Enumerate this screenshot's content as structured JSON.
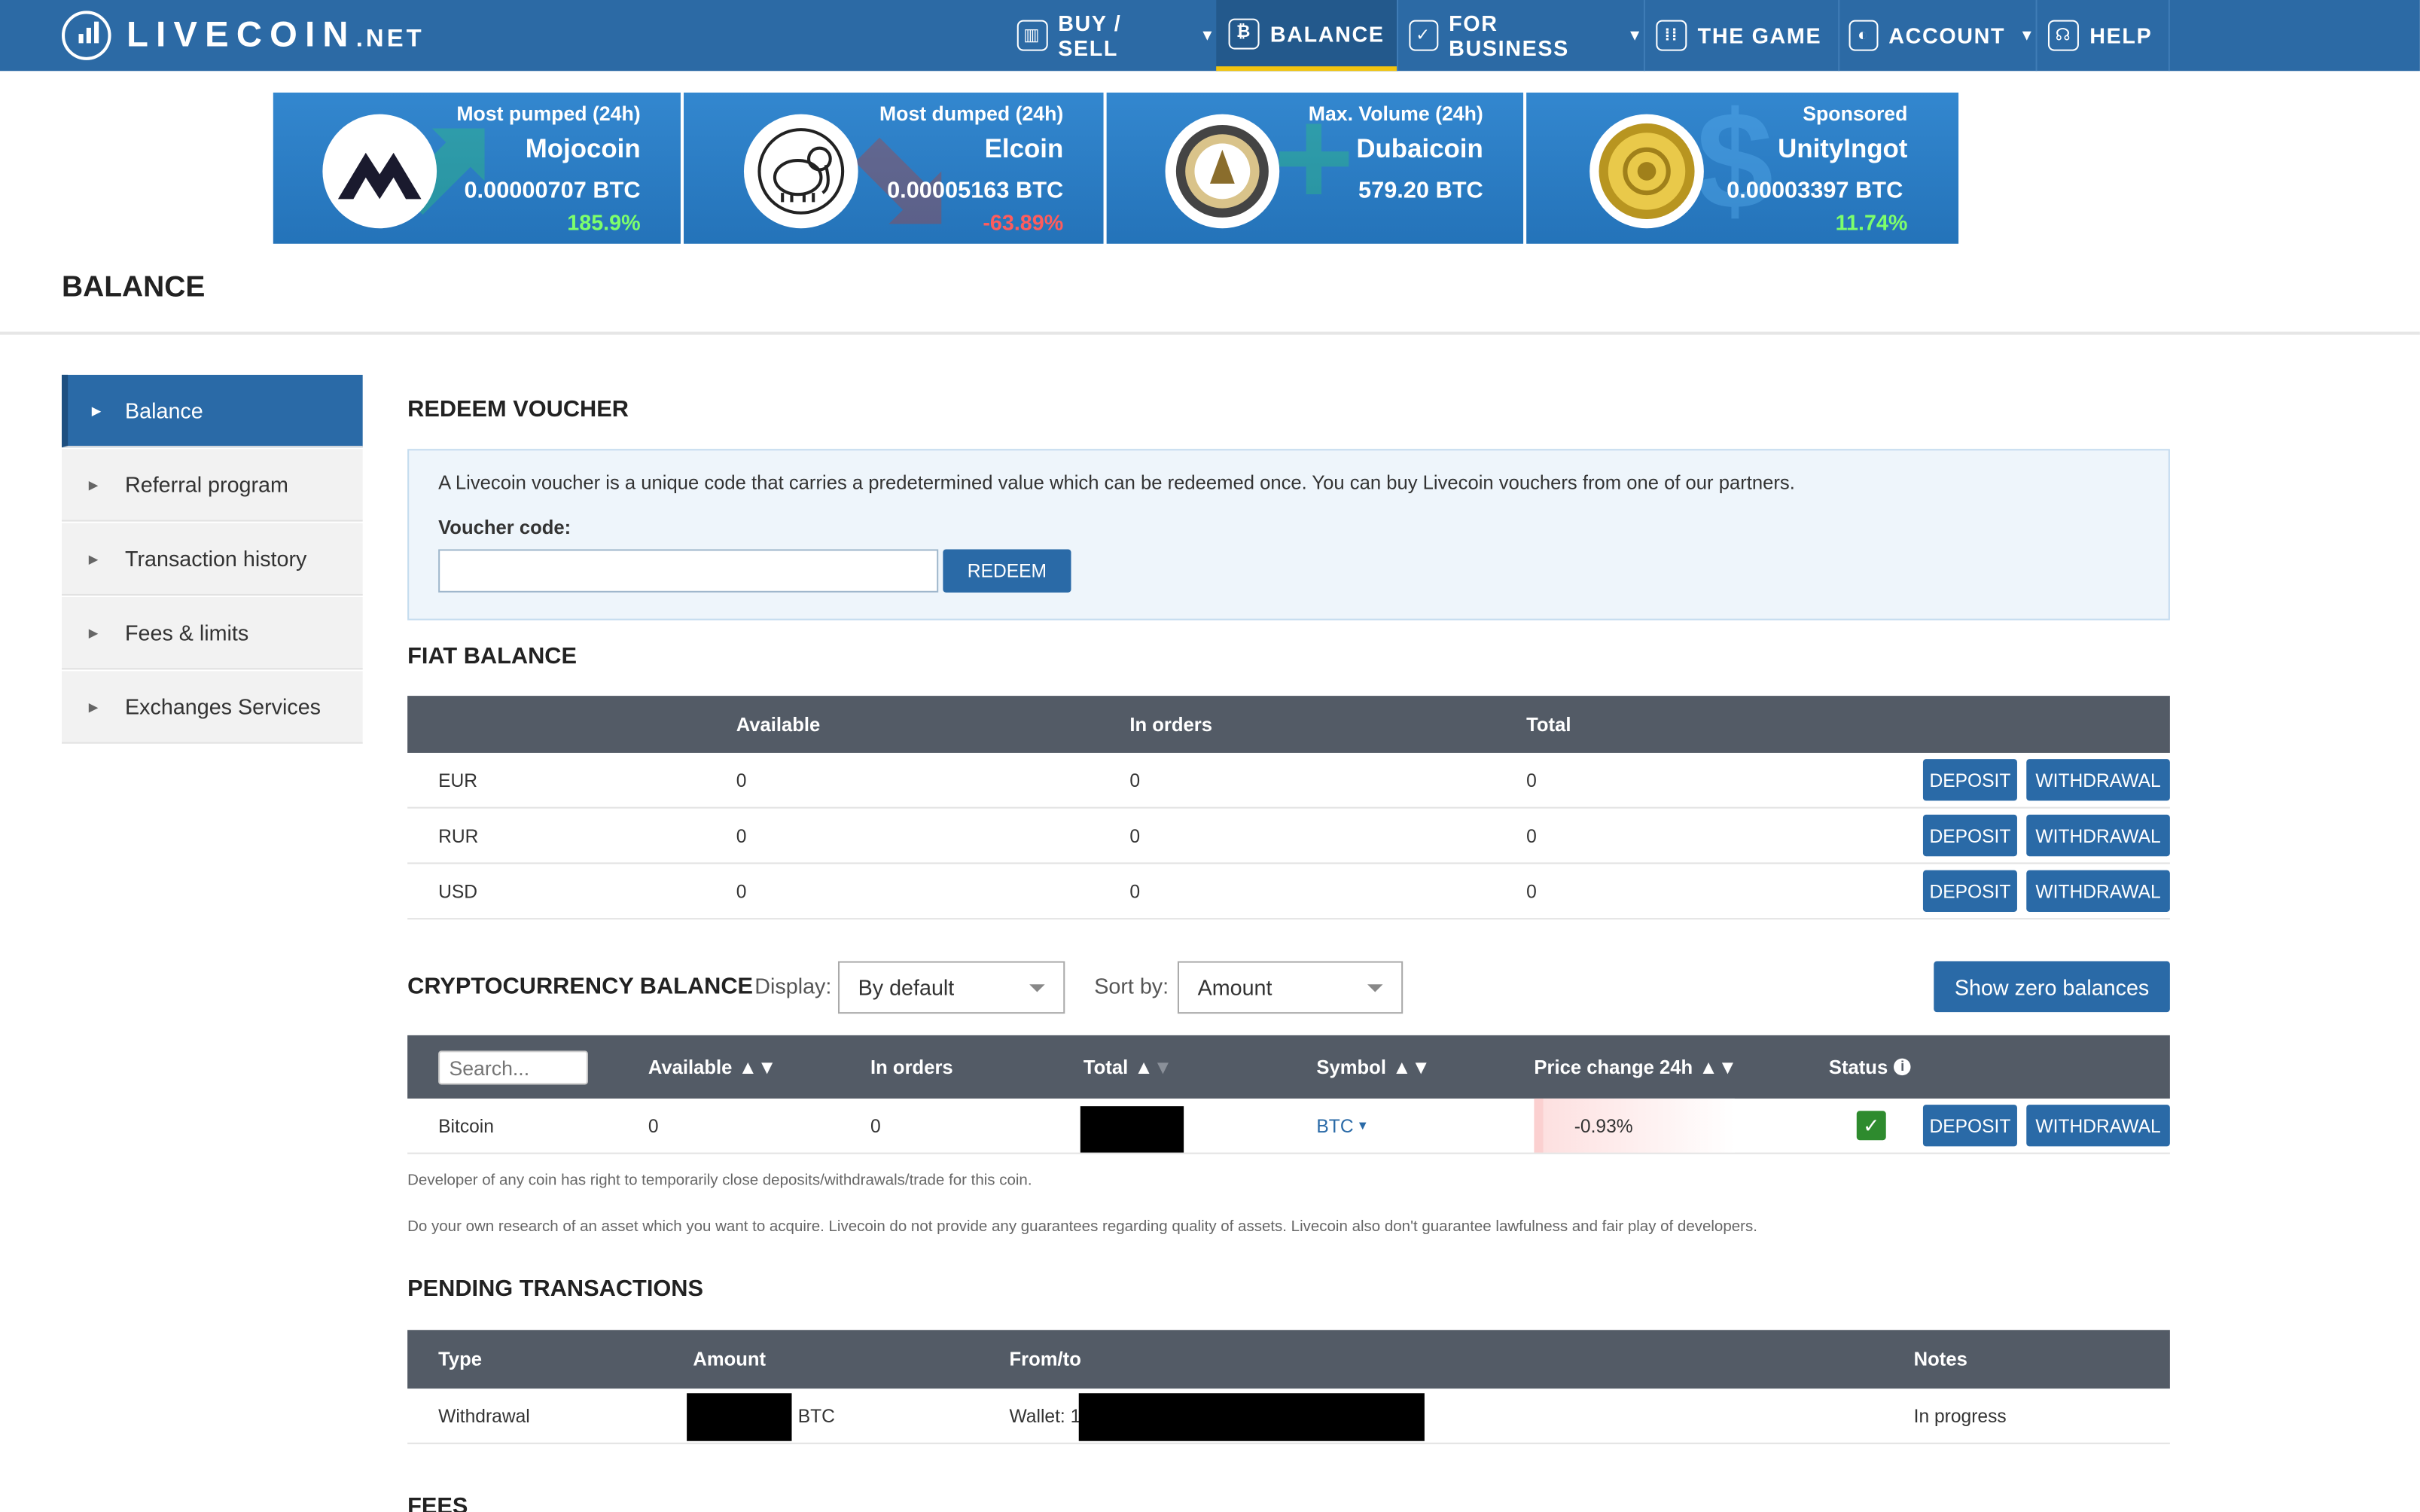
{
  "brand": {
    "name": "LIVECOIN",
    "tld": ".NET"
  },
  "nav": {
    "buy_sell": "BUY / SELL",
    "balance": "BALANCE",
    "for_business": "FOR BUSINESS",
    "the_game": "THE GAME",
    "account": "ACCOUNT",
    "help": "HELP"
  },
  "banner": [
    {
      "label": "Most pumped (24h)",
      "coin": "Mojocoin",
      "price": "0.00000707 BTC",
      "change": "185.9%",
      "change_color": "#7dff6b"
    },
    {
      "label": "Most dumped (24h)",
      "coin": "Elcoin",
      "price": "0.00005163 BTC",
      "change": "-63.89%",
      "change_color": "#ff5c5c"
    },
    {
      "label": "Max. Volume (24h)",
      "coin": "Dubaicoin",
      "price": "579.20 BTC",
      "change": "",
      "change_color": "#ffffff"
    },
    {
      "label": "Sponsored",
      "coin": "UnityIngot",
      "price": "0.00003397 BTC",
      "change": "11.74%",
      "change_color": "#7dff6b"
    }
  ],
  "page_title": "BALANCE",
  "sidebar": {
    "items": [
      {
        "label": "Balance",
        "active": true
      },
      {
        "label": "Referral program"
      },
      {
        "label": "Transaction history"
      },
      {
        "label": "Fees & limits"
      },
      {
        "label": "Exchanges Services"
      }
    ]
  },
  "voucher": {
    "title": "REDEEM VOUCHER",
    "description": "A Livecoin voucher is a unique code that carries a predetermined value which can be redeemed once. You can buy Livecoin vouchers from one of our partners.",
    "code_label": "Voucher code:",
    "code_value": "",
    "redeem_label": "REDEEM"
  },
  "fiat": {
    "title": "FIAT BALANCE",
    "headers": {
      "available": "Available",
      "in_orders": "In orders",
      "total": "Total"
    },
    "deposit_label": "DEPOSIT",
    "withdrawal_label": "WITHDRAWAL",
    "rows": [
      {
        "currency": "EUR",
        "available": "0",
        "in_orders": "0",
        "total": "0"
      },
      {
        "currency": "RUR",
        "available": "0",
        "in_orders": "0",
        "total": "0"
      },
      {
        "currency": "USD",
        "available": "0",
        "in_orders": "0",
        "total": "0"
      }
    ]
  },
  "crypto": {
    "title": "CRYPTOCURRENCY BALANCE",
    "display_label": "Display:",
    "display_value": "By default",
    "sort_label": "Sort by:",
    "sort_value": "Amount",
    "show_zero_label": "Show zero balances",
    "search_placeholder": "Search...",
    "headers": {
      "available": "Available",
      "in_orders": "In orders",
      "total": "Total",
      "symbol": "Symbol",
      "price_change": "Price change 24h",
      "status": "Status"
    },
    "rows": [
      {
        "name": "Bitcoin",
        "available": "0",
        "in_orders": "0",
        "total": "",
        "symbol": "BTC",
        "price_change": "-0.93%",
        "status": "ok"
      }
    ],
    "deposit_label": "DEPOSIT",
    "withdrawal_label": "WITHDRAWAL",
    "note1": "Developer of any coin has right to temporarily close deposits/withdrawals/trade for this coin.",
    "note2": "Do your own research of an asset which you want to acquire. Livecoin do not provide any guarantees regarding quality of assets. Livecoin also don't guarantee lawfulness and fair play of developers."
  },
  "pending": {
    "title": "PENDING TRANSACTIONS",
    "headers": {
      "type": "Type",
      "amount": "Amount",
      "from_to": "From/to",
      "notes": "Notes"
    },
    "rows": [
      {
        "type": "Withdrawal",
        "amount_currency": "BTC",
        "wallet_prefix": "Wallet: 1",
        "notes": "In progress"
      }
    ]
  },
  "fees_title": "FEES",
  "colors": {
    "nav": "#2c6aa5",
    "accent": "#2a6aa7",
    "table_header": "#535b66",
    "active_underline": "#f1c40f"
  }
}
